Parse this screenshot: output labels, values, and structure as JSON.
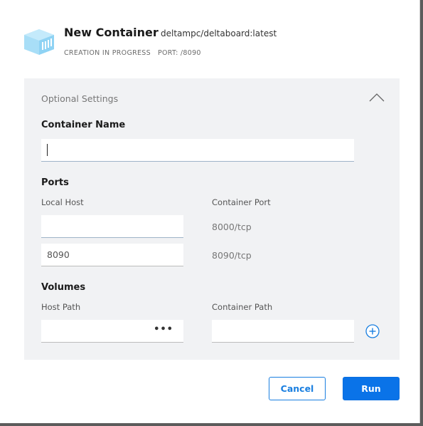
{
  "header": {
    "title": "New Container",
    "image": "deltampc/deltaboard:latest",
    "status": "CREATION IN PROGRESS",
    "port": "PORT: /8090",
    "logo_icon": "container-box-icon"
  },
  "optional_settings": {
    "title": "Optional Settings",
    "collapse_icon": "chevron-up-icon",
    "container_name": {
      "label": "Container Name",
      "value": ""
    },
    "ports": {
      "label": "Ports",
      "local_host_label": "Local Host",
      "container_port_label": "Container Port",
      "rows": [
        {
          "local_host": "",
          "container_port": "8000/tcp"
        },
        {
          "local_host": "8090",
          "container_port": "8090/tcp"
        }
      ]
    },
    "volumes": {
      "label": "Volumes",
      "host_path_label": "Host Path",
      "container_path_label": "Container Path",
      "host_path": "",
      "container_path": "",
      "browse_label": "•••",
      "add_icon": "plus-circle-icon"
    }
  },
  "footer": {
    "cancel_label": "Cancel",
    "run_label": "Run"
  },
  "colors": {
    "accent": "#0a73e8",
    "panel_bg": "#f1f2f4",
    "logo": "#8fd3f4"
  }
}
